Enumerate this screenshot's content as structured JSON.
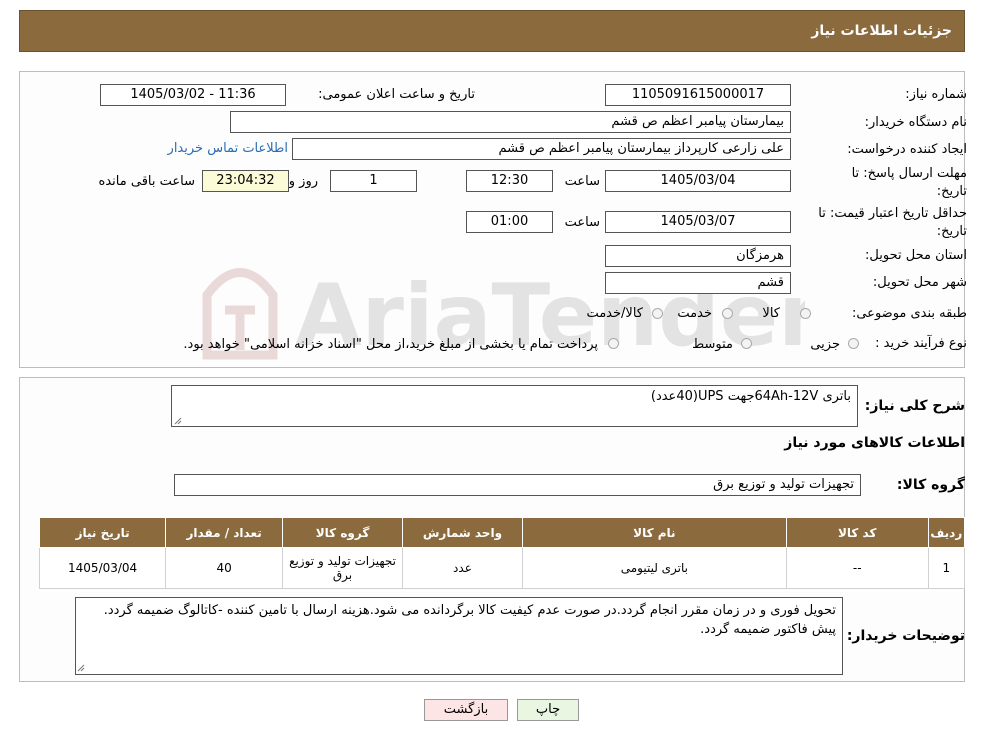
{
  "header": {
    "title": "جزئیات اطلاعات نیاز"
  },
  "form": {
    "need_number_label": "شماره نیاز:",
    "need_number": "1105091615000017",
    "announce_label": "تاریخ و ساعت اعلان عمومی:",
    "announce_value": "1405/03/02 - 11:36",
    "buyer_org_label": "نام دستگاه خریدار:",
    "buyer_org": "بیمارستان پیامبر اعظم  ص  قشم",
    "creator_label": "ایجاد کننده درخواست:",
    "creator": "علی زارعی کارپرداز بیمارستان پیامبر اعظم  ص  قشم",
    "contact_link": "اطلاعات تماس خریدار",
    "deadline_label_1": "مهلت ارسال پاسخ: تا",
    "deadline_label_2": "تاریخ:",
    "deadline_date": "1405/03/04",
    "time_label": "ساعت",
    "deadline_time": "12:30",
    "days": "1",
    "days_label": "روز و",
    "remaining": "23:04:32",
    "remaining_label": "ساعت باقی مانده",
    "validity_label_1": "حداقل تاریخ اعتبار قیمت: تا",
    "validity_label_2": "تاریخ:",
    "validity_date": "1405/03/07",
    "validity_time": "01:00",
    "province_label": "استان محل تحویل:",
    "province": "هرمزگان",
    "city_label": "شهر محل تحویل:",
    "city": "قشم",
    "category_label": "طبقه بندی موضوعی:",
    "category_options": [
      "کالا",
      "خدمت",
      "کالا/خدمت"
    ],
    "process_label": "نوع فرآیند خرید :",
    "process_options": [
      "جزیی",
      "متوسط"
    ],
    "process_note": "پرداخت تمام یا بخشی از مبلغ خرید،از محل \"اسناد خزانه اسلامی\" خواهد بود."
  },
  "summary": {
    "label": "شرح کلی نیاز:",
    "text": "باتری 64Ah-12Vجهت UPS(40عدد)"
  },
  "goods_section": {
    "title": "اطلاعات کالاهای مورد نیاز",
    "group_label": "گروه کالا:",
    "group_value": "تجهیزات تولید و توزیع برق"
  },
  "table": {
    "headers": [
      "ردیف",
      "کد کالا",
      "نام کالا",
      "واحد شمارش",
      "گروه کالا",
      "تعداد / مقدار",
      "تاریخ نیاز"
    ],
    "rows": [
      [
        "1",
        "--",
        "باتری لیتیومی",
        "عدد",
        "تجهیزات تولید و توزیع برق",
        "40",
        "1405/03/04"
      ]
    ]
  },
  "buyer_notes": {
    "label": "توضیحات خریدار:",
    "text": "تحویل فوری و در زمان مقرر انجام گردد.در صورت عدم کیفیت کالا برگردانده می شود.هزینه ارسال با تامین کننده -کاتالوگ ضمیمه گردد. پیش فاکتور ضمیمه گردد."
  },
  "buttons": {
    "print": "چاپ",
    "back": "بازگشت"
  },
  "colors": {
    "header_bg": "#8B6B3D",
    "link": "#2a6db3",
    "remaining_bg": "#fbfbd8",
    "back_bg": "#fde5e5",
    "print_bg": "#e9f7e2"
  },
  "watermark": {
    "text": "AriaTender.neT"
  }
}
